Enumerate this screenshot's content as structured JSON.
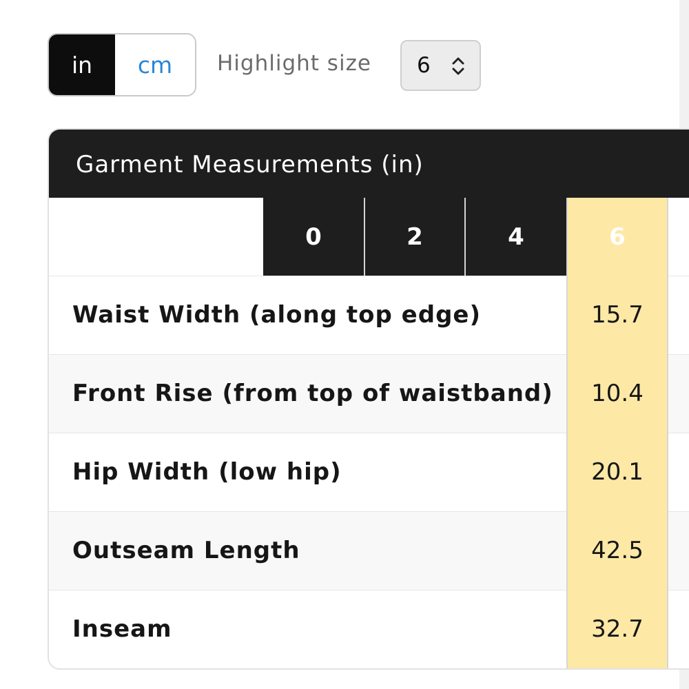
{
  "units": {
    "options": [
      "in",
      "cm"
    ],
    "selected": "in"
  },
  "highlight": {
    "label": "Highlight size",
    "value": "6"
  },
  "table": {
    "title": "Garment Measurements (in)",
    "sizes": [
      "0",
      "2",
      "4",
      "6"
    ],
    "highlighted_size": "6",
    "rows": [
      {
        "label": "Waist Width (along top edge)",
        "value": "15.7"
      },
      {
        "label": "Front Rise (from top of waistband)",
        "value": "10.4"
      },
      {
        "label": "Hip Width (low hip)",
        "value": "20.1"
      },
      {
        "label": "Outseam Length",
        "value": "42.5"
      },
      {
        "label": "Inseam",
        "value": "32.7"
      }
    ]
  },
  "colors": {
    "header_bg": "#1e1e1e",
    "highlight_bg": "#fde8a6",
    "link_blue": "#2a86d6"
  }
}
